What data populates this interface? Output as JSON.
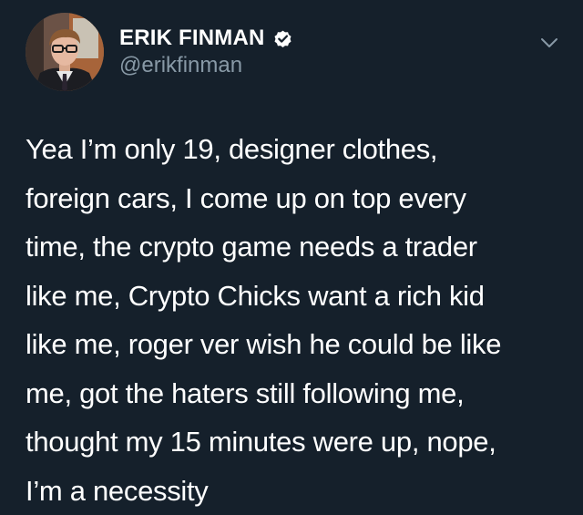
{
  "author": {
    "display_name": "ERIK FINMAN",
    "handle": "@erikfinman",
    "verified": true,
    "avatar_icon": "profile-photo"
  },
  "menu": {
    "icon": "chevron-down-icon"
  },
  "tweet": {
    "lines": [
      "Yea I’m only 19, designer clothes,",
      "foreign cars, I come up on top every",
      "time, the crypto game needs a trader",
      "like me, Crypto Chicks want a rich kid",
      "like me, roger ver wish he could be like",
      "me, got the haters still following me,",
      "thought my 15 minutes were up, nope,",
      "I’m a necessity"
    ]
  },
  "colors": {
    "background": "#15202b",
    "text_primary": "#ffffff",
    "text_secondary": "#8899a6"
  }
}
